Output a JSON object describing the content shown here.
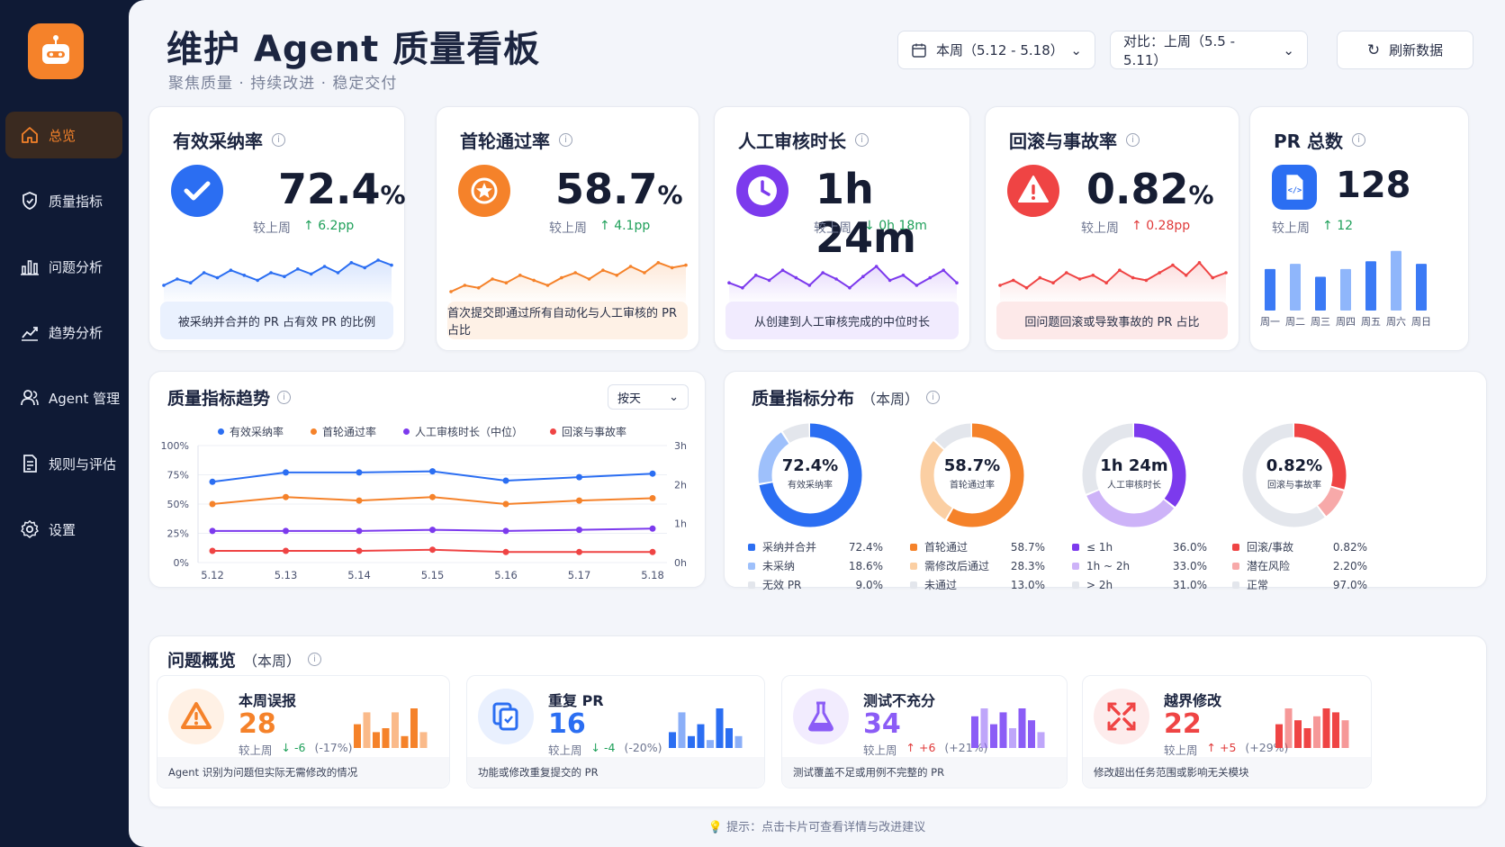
{
  "header": {
    "title": "维护 Agent 质量看板",
    "subtitle": "聚焦质量 · 持续改进 · 稳定交付",
    "period_select": "本周（5.12 - 5.18）",
    "compare_select": "对比：上周（5.5 - 5.11）",
    "refresh_label": "刷新数据"
  },
  "sidebar": {
    "items": [
      {
        "label": "总览",
        "icon": "home-icon"
      },
      {
        "label": "质量指标",
        "icon": "shield-icon"
      },
      {
        "label": "问题分析",
        "icon": "bar-chart-icon"
      },
      {
        "label": "趋势分析",
        "icon": "trend-icon"
      },
      {
        "label": "Agent 管理",
        "icon": "users-icon"
      },
      {
        "label": "规则与评估",
        "icon": "document-icon"
      },
      {
        "label": "设置",
        "icon": "gear-icon"
      }
    ]
  },
  "kpis": [
    {
      "title": "有效采纳率",
      "value": "72.4",
      "unit": "%",
      "cmp_label": "较上周",
      "delta": "6.2pp",
      "dir": "up",
      "desc": "被采纳并合并的 PR 占有效 PR 的比例",
      "color": "#2b6ef2"
    },
    {
      "title": "首轮通过率",
      "value": "58.7",
      "unit": "%",
      "cmp_label": "较上周",
      "delta": "4.1pp",
      "dir": "up",
      "desc": "首次提交即通过所有自动化与人工审核的 PR 占比",
      "color": "#f5822a"
    },
    {
      "title": "人工审核时长",
      "value": "1h 24m",
      "unit": "",
      "cmp_label": "较上周",
      "delta": "0h 18m",
      "dir": "down",
      "desc": "从创建到人工审核完成的中位时长",
      "color": "#7c3aed"
    },
    {
      "title": "回滚与事故率",
      "value": "0.82",
      "unit": "%",
      "cmp_label": "较上周",
      "delta": "0.28pp",
      "dir": "up-bad",
      "desc": "回问题回滚或导致事故的 PR 占比",
      "color": "#ef4444"
    },
    {
      "title": "PR 总数",
      "value": "128",
      "unit": "",
      "cmp_label": "较上周",
      "delta": "12",
      "dir": "up",
      "desc": "",
      "color": "#2b6ef2"
    }
  ],
  "pr_weekly": {
    "days": [
      "周一",
      "周二",
      "周三",
      "周四",
      "周五",
      "周六",
      "周日"
    ],
    "values": [
      16,
      18,
      13,
      16,
      19,
      23,
      18
    ]
  },
  "sparklines": [
    [
      40,
      45,
      42,
      50,
      46,
      52,
      48,
      44,
      50,
      47,
      53,
      49,
      55,
      50,
      58,
      54,
      60,
      56
    ],
    [
      35,
      40,
      38,
      45,
      42,
      48,
      44,
      40,
      46,
      50,
      45,
      52,
      48,
      55,
      50,
      58,
      54,
      56
    ],
    [
      42,
      38,
      48,
      44,
      52,
      46,
      40,
      50,
      45,
      38,
      47,
      55,
      44,
      48,
      40,
      46,
      52,
      42
    ],
    [
      40,
      44,
      38,
      46,
      42,
      50,
      45,
      48,
      42,
      52,
      46,
      44,
      50,
      56,
      48,
      58,
      46,
      50
    ]
  ],
  "trend": {
    "title": "质量指标趋势",
    "granularity": "按天",
    "chart_data": {
      "type": "line",
      "x": [
        "5.12",
        "5.13",
        "5.14",
        "5.15",
        "5.16",
        "5.17",
        "5.18"
      ],
      "y_left_ticks": [
        "100%",
        "75%",
        "50%",
        "25%",
        "0%"
      ],
      "y_right_ticks": [
        "3h",
        "2h",
        "1h",
        "0h"
      ],
      "series": [
        {
          "name": "有效采纳率",
          "color": "#2b6ef2",
          "values": [
            69,
            77,
            77,
            78,
            70,
            73,
            76
          ]
        },
        {
          "name": "首轮通过率",
          "color": "#f5822a",
          "values": [
            50,
            56,
            53,
            56,
            50,
            53,
            55
          ]
        },
        {
          "name": "人工审核时长（中位）",
          "color": "#7c3aed",
          "values": [
            27,
            27,
            27,
            28,
            27,
            28,
            29
          ]
        },
        {
          "name": "回滚与事故率",
          "color": "#ef4444",
          "values": [
            10,
            10,
            10,
            11,
            9,
            9,
            9
          ]
        }
      ]
    }
  },
  "distribution": {
    "title": "质量指标分布",
    "scope": "（本周）",
    "donuts": [
      {
        "center": "72.4%",
        "label": "有效采纳率",
        "colors": [
          "#2b6ef2",
          "#9ec0fb",
          "#e3e6ec"
        ],
        "items": [
          [
            "采纳并合并",
            "72.4%"
          ],
          [
            "未采纳",
            "18.6%"
          ],
          [
            "无效 PR",
            "9.0%"
          ]
        ],
        "values": [
          72.4,
          18.6,
          9.0
        ]
      },
      {
        "center": "58.7%",
        "label": "首轮通过率",
        "colors": [
          "#f5822a",
          "#fbcfa3",
          "#e3e6ec"
        ],
        "items": [
          [
            "首轮通过",
            "58.7%"
          ],
          [
            "需修改后通过",
            "28.3%"
          ],
          [
            "未通过",
            "13.0%"
          ]
        ],
        "values": [
          58.7,
          28.3,
          13.0
        ]
      },
      {
        "center": "1h 24m",
        "label": "人工审核时长",
        "colors": [
          "#7c3aed",
          "#cdb3f8",
          "#e3e6ec"
        ],
        "items": [
          [
            "≤ 1h",
            "36.0%"
          ],
          [
            "1h ~ 2h",
            "33.0%"
          ],
          [
            "> 2h",
            "31.0%"
          ]
        ],
        "values": [
          36,
          33,
          31
        ]
      },
      {
        "center": "0.82%",
        "label": "回滚与事故率",
        "colors": [
          "#ef4444",
          "#f7a9a9",
          "#e3e6ec"
        ],
        "items": [
          [
            "回滚/事故",
            "0.82%"
          ],
          [
            "潜在风险",
            "2.20%"
          ],
          [
            "正常",
            "97.0%"
          ]
        ],
        "values": [
          30,
          10,
          60
        ]
      }
    ]
  },
  "issues": {
    "title": "问题概览",
    "scope": "（本周）",
    "cards": [
      {
        "name": "本周误报",
        "value": "28",
        "cmp": "较上周",
        "delta": "-6",
        "pct": "(-17%)",
        "dir": "down",
        "desc": "Agent 识别为问题但实际无需修改的情况",
        "color": "#f5822a",
        "bars": [
          6,
          9,
          4,
          5,
          9,
          3,
          10,
          4
        ]
      },
      {
        "name": "重复 PR",
        "value": "16",
        "cmp": "较上周",
        "delta": "-4",
        "pct": "(-20%)",
        "dir": "down",
        "desc": "功能或修改重复提交的 PR",
        "color": "#2b6ef2",
        "bars": [
          4,
          9,
          3,
          6,
          2,
          10,
          5,
          3
        ]
      },
      {
        "name": "测试不充分",
        "value": "34",
        "cmp": "较上周",
        "delta": "+6",
        "pct": "(+21%)",
        "dir": "up",
        "desc": "测试覆盖不足或用例不完整的 PR",
        "color": "#8b5cf6",
        "bars": [
          8,
          10,
          6,
          9,
          5,
          10,
          7,
          4
        ]
      },
      {
        "name": "越界修改",
        "value": "22",
        "cmp": "较上周",
        "delta": "+5",
        "pct": "(+29%)",
        "dir": "up",
        "desc": "修改超出任务范围或影响无关模块",
        "color": "#ef4444",
        "bars": [
          6,
          10,
          7,
          5,
          8,
          10,
          9,
          7
        ]
      }
    ]
  },
  "tip": "提示：点击卡片可查看详情与改进建议"
}
